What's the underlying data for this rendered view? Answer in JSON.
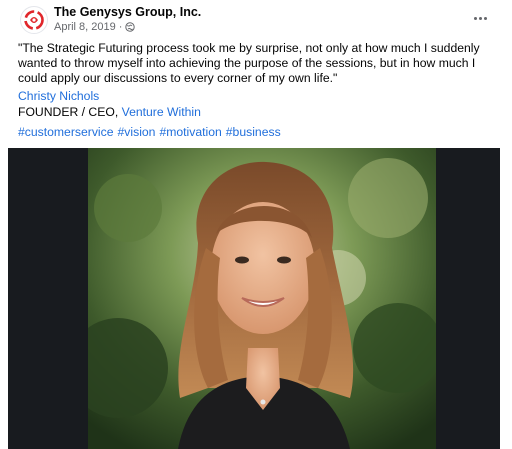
{
  "post": {
    "page_name": "The Genysys Group, Inc.",
    "date": "April 8, 2019",
    "separator": "·",
    "privacy_icon": "globe-icon",
    "more_icon": "more-options-icon",
    "body": "\"The Strategic Futuring process took me by surprise, not only at how much I suddenly wanted to throw myself into achieving the purpose of the sessions, but in how much I could apply our discussions to every corner of my own life.\"",
    "author_name": "Christy Nichols",
    "author_role": "FOUNDER / CEO,",
    "author_company": "Venture Within",
    "hashtags": [
      "#customerservice",
      "#vision",
      "#motivation",
      "#business"
    ],
    "colors": {
      "link": "#216fdb",
      "meta": "#65676b",
      "brand_red": "#e0262b",
      "photo_background": "#181b1f"
    }
  }
}
